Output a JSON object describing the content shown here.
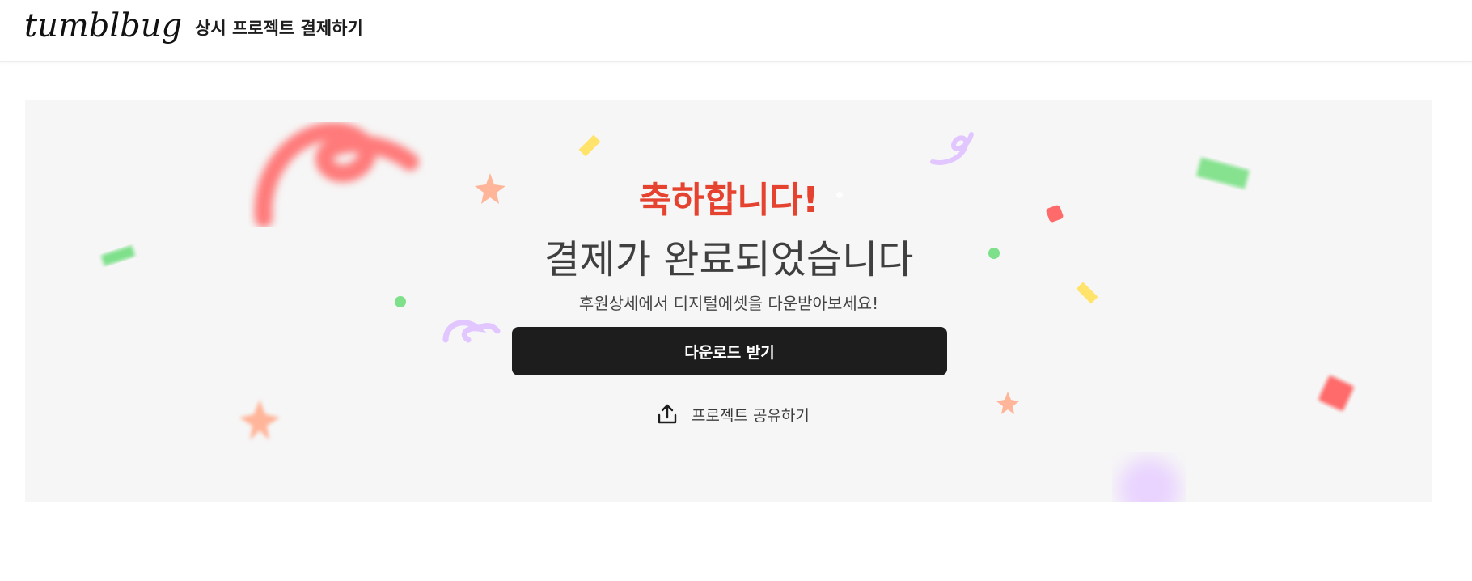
{
  "header": {
    "logo": "tumblbug",
    "separator": "·",
    "title": "상시 프로젝트 결제하기"
  },
  "banner": {
    "headline": "축하합니다!",
    "subheadline": "결제가 완료되었습니다",
    "info": "후원상세에서 디지털에셋을 다운받아보세요!",
    "download_label": "다운로드 받기",
    "share_label": "프로젝트 공유하기"
  },
  "colors": {
    "accent": "#e5432f",
    "button": "#1d1d1d",
    "banner_bg": "#f6f6f6"
  },
  "icons": {
    "share": "share-upload-icon"
  }
}
